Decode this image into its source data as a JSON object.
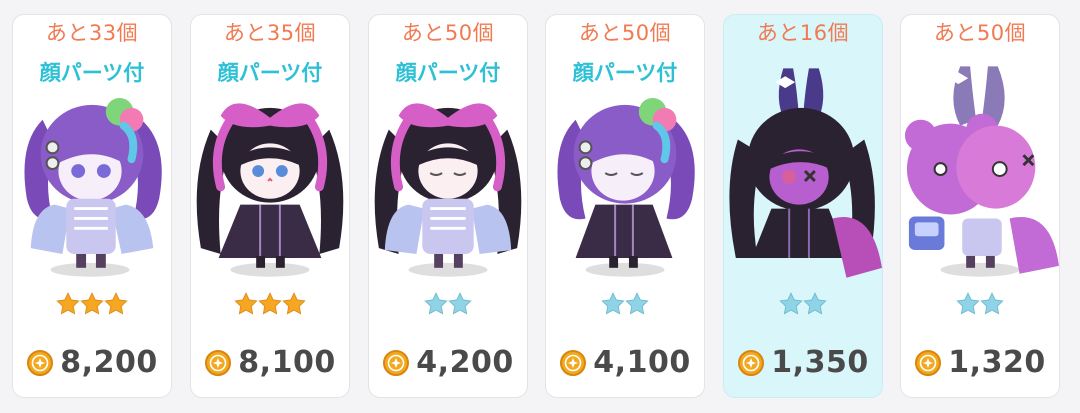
{
  "items": [
    {
      "remaining": "あと33個",
      "tag": "顔パーツ付",
      "rarity": 3,
      "rarity_color": "gold",
      "price": "8,200",
      "avatar": "twin-tail-purple-icon",
      "selected": false
    },
    {
      "remaining": "あと35個",
      "tag": "顔パーツ付",
      "rarity": 3,
      "rarity_color": "gold",
      "price": "8,100",
      "avatar": "pink-bow-dark-dress-icon",
      "selected": false
    },
    {
      "remaining": "あと50個",
      "tag": "顔パーツ付",
      "rarity": 2,
      "rarity_color": "blue",
      "price": "4,200",
      "avatar": "pink-bow-sleepy-icon",
      "selected": false
    },
    {
      "remaining": "あと50個",
      "tag": "顔パーツ付",
      "rarity": 2,
      "rarity_color": "blue",
      "price": "4,100",
      "avatar": "twin-tail-sleepy-icon",
      "selected": false
    },
    {
      "remaining": "あと16個",
      "tag": "",
      "rarity": 2,
      "rarity_color": "blue",
      "price": "1,350",
      "avatar": "bunny-hood-dark-icon",
      "selected": true
    },
    {
      "remaining": "あと50個",
      "tag": "",
      "rarity": 2,
      "rarity_color": "blue",
      "price": "1,320",
      "avatar": "pink-bear-plush-icon",
      "selected": false
    }
  ],
  "colors": {
    "remaining_text": "#f07a52",
    "tag_text": "#2ec1d6",
    "star_gold": "#f5a623",
    "star_blue": "#8fd4e6",
    "price_text": "#4a4a4a",
    "coin": "#f3a91f",
    "selected_bg": "#d9f7fa"
  }
}
